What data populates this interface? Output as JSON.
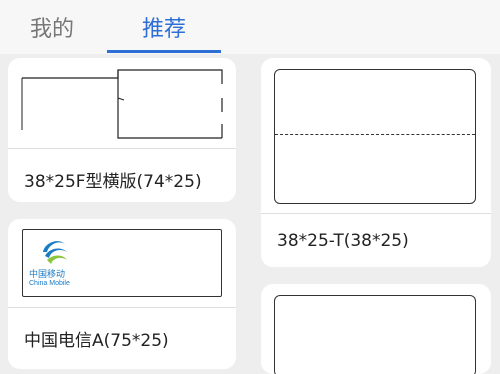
{
  "tabs": {
    "mine": "我的",
    "recommend": "推荐"
  },
  "cards": [
    {
      "label": "38*25F型横版(74*25)"
    },
    {
      "label": "38*25-T(38*25)"
    },
    {
      "label": "中国电信A(75*25)",
      "logo": {
        "cn": "中国移动",
        "en": "China Mobile"
      }
    },
    {
      "label": ""
    }
  ],
  "colors": {
    "accent": "#2e6fd6",
    "logo_blue": "#1a7bc6",
    "logo_green": "#8cc63f"
  }
}
